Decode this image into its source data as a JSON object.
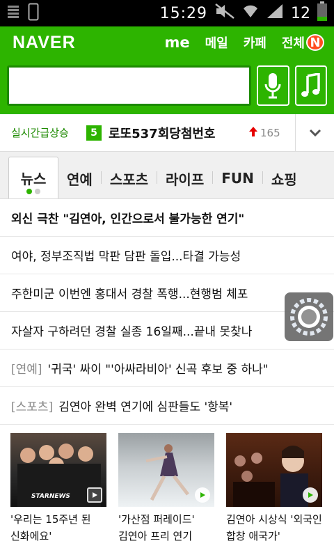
{
  "status": {
    "time": "15:29",
    "battery": "12"
  },
  "header": {
    "logo": "NAVER",
    "links": [
      "me",
      "메일",
      "카페",
      "전체"
    ],
    "badge": "N",
    "search_value": ""
  },
  "realtime": {
    "label": "실시간급상승",
    "rank": "5",
    "keyword": "로또537회당첨번호",
    "count": "165"
  },
  "tabs": [
    "뉴스",
    "연예",
    "스포츠",
    "라이프",
    "FUN",
    "쇼핑"
  ],
  "news": [
    {
      "text": "외신 극찬 \"김연아, 인간으로서 불가능한 연기\""
    },
    {
      "text": "여야, 정부조직법 막판 담판 돌입...타결 가능성"
    },
    {
      "text": "주한미군 이번엔 홍대서 경찰 폭행...현행범 체포"
    },
    {
      "text": "자살자 구하려던 경찰 실종 16일째...끝내 못찾나"
    },
    {
      "category": "[연예]",
      "text": "'귀국' 싸이 \"'아싸라비아' 신곡 후보 중 하나\""
    },
    {
      "category": "[스포츠]",
      "text": "김연아 완벽 연기에 심판들도 '항복'"
    }
  ],
  "thumbs": [
    {
      "caption": "'우리는 15주년 된 신화에요'",
      "watermark": "STARNEWS"
    },
    {
      "caption": "'가산점 퍼레이드' 김연아 프리 연기"
    },
    {
      "caption": "김연아 시상식 '외국인 합창 애국가'"
    }
  ],
  "colors": {
    "naver_green": "#2db400",
    "badge_red": "#ff4c1f"
  }
}
